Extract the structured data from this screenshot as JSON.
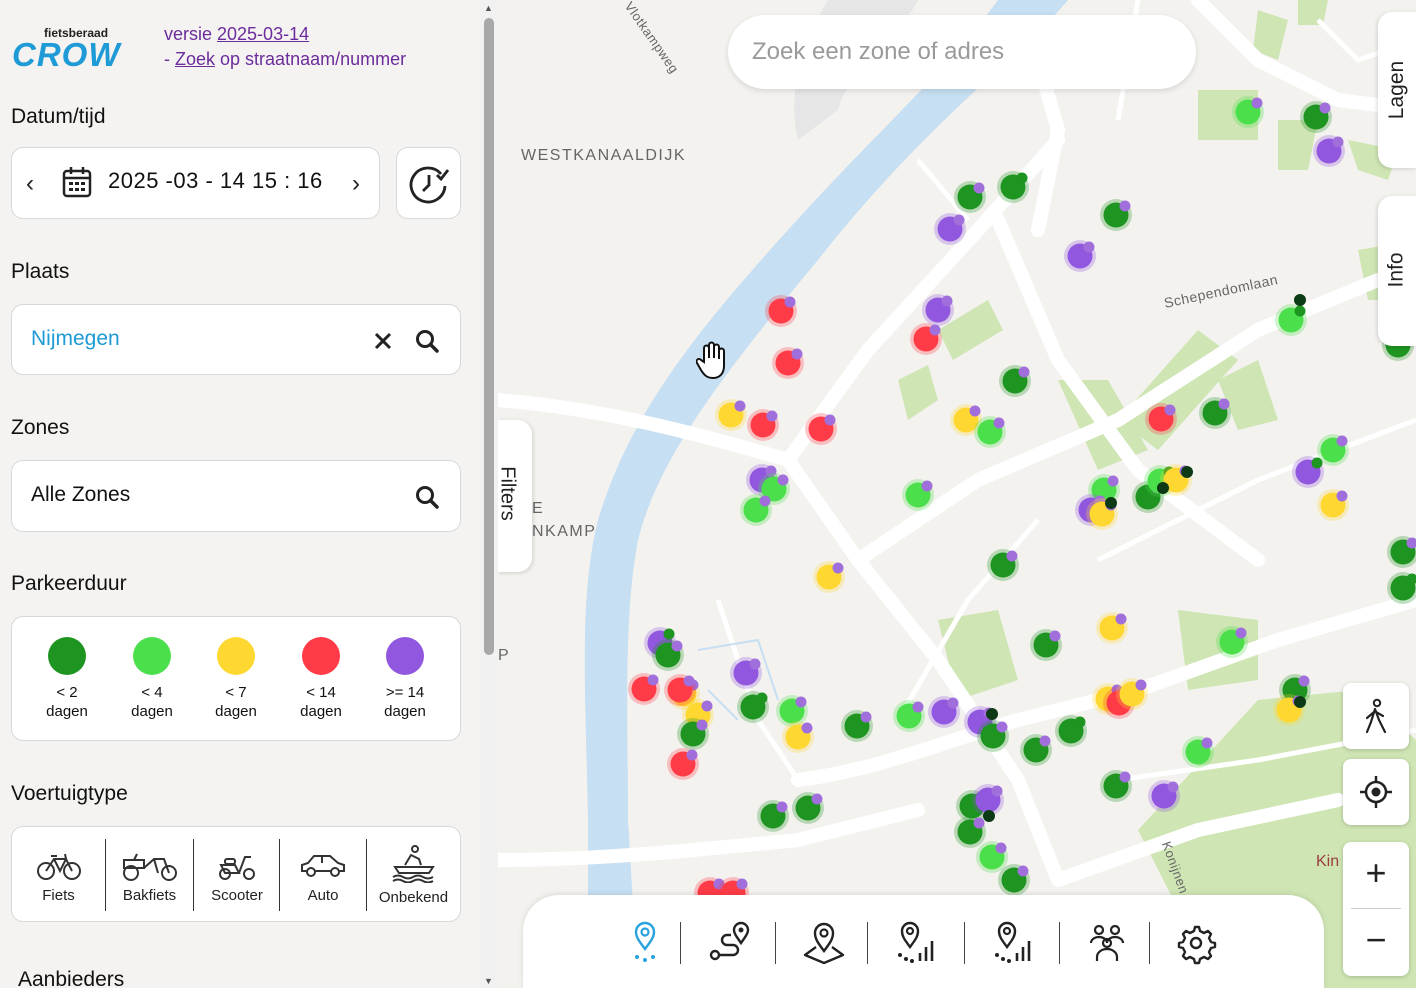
{
  "logo": {
    "small": "fietsberaad",
    "big": "CROW"
  },
  "version": {
    "prefix": "versie ",
    "date": "2025-03-14",
    "line2_prefix": "- ",
    "zoek": "Zoek",
    "line2_suffix": " op straatnaam/nummer"
  },
  "datetime": {
    "label": "Datum/tijd",
    "prev": "‹",
    "next": "›",
    "value": "2025 -03 - 14   15 : 16"
  },
  "place": {
    "label": "Plaats",
    "value": "Nijmegen"
  },
  "zones": {
    "label": "Zones",
    "value": "Alle Zones"
  },
  "duration": {
    "label": "Parkeerduur",
    "items": [
      {
        "line1": "< 2",
        "line2": "dagen",
        "color": "#1e9421"
      },
      {
        "line1": "< 4",
        "line2": "dagen",
        "color": "#4be04b"
      },
      {
        "line1": "< 7",
        "line2": "dagen",
        "color": "#ffd731"
      },
      {
        "line1": "< 14",
        "line2": "dagen",
        "color": "#ff3b47"
      },
      {
        "line1": ">= 14",
        "line2": "dagen",
        "color": "#9157de"
      }
    ]
  },
  "vehicle": {
    "label": "Voertuigtype",
    "items": [
      {
        "label": "Fiets",
        "icon": "bicycle-icon"
      },
      {
        "label": "Bakfiets",
        "icon": "cargo-bike-icon"
      },
      {
        "label": "Scooter",
        "icon": "scooter-icon"
      },
      {
        "label": "Auto",
        "icon": "car-icon"
      },
      {
        "label": "Onbekend",
        "icon": "unknown-vehicle-icon"
      }
    ]
  },
  "providers": {
    "label": "Aanbieders"
  },
  "map": {
    "search_placeholder": "Zoek een zone of adres",
    "labels": {
      "westkanaaldijk": "WESTKANAALDIJK",
      "schependomlaan": "Schependomlaan",
      "vlotkampweg": "Vlotkampweg",
      "kamp": "NKAMP",
      "e": "E",
      "p": "P",
      "kin": "Kin",
      "konijnen": "Konijnen"
    },
    "tabs": {
      "lagen": "Lagen",
      "info": "Info",
      "filters": "Filters"
    },
    "zoom_in": "+",
    "zoom_out": "−"
  },
  "toolbar": {
    "tools": [
      "location-pin-icon",
      "route-icon",
      "area-pin-icon",
      "signal-pin-icon",
      "signal-pin-2-icon",
      "users-icon",
      "gear-icon"
    ]
  }
}
